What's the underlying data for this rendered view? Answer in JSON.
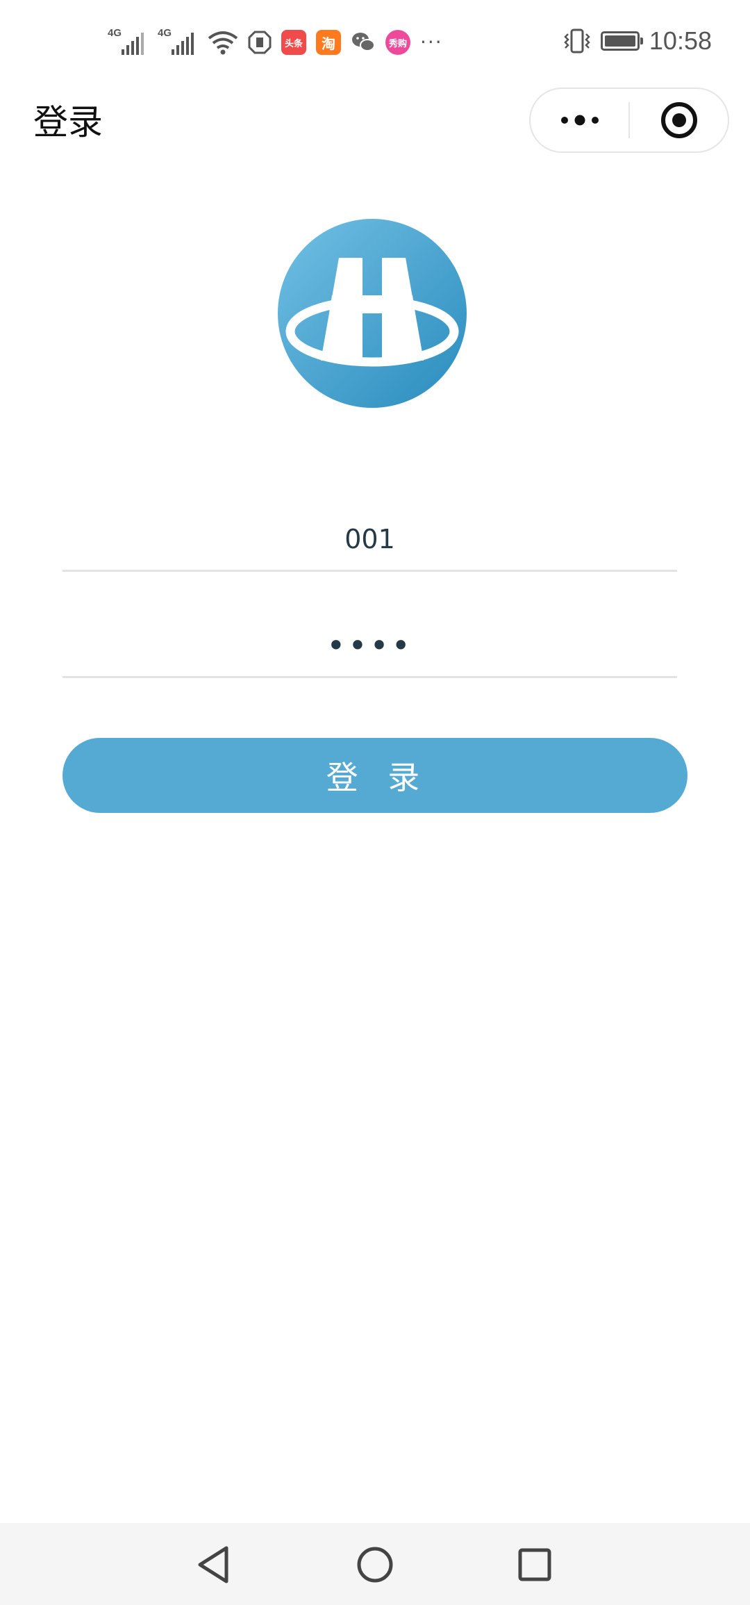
{
  "status_bar": {
    "network_1": "4G",
    "network_2": "4G",
    "app_icons": [
      {
        "name": "toutiao-icon",
        "label": "头条",
        "color": "#f04a4a"
      },
      {
        "name": "taobao-icon",
        "label": "淘",
        "color": "#ff7a1f"
      },
      {
        "name": "wechat-icon",
        "label": "",
        "color": "#666666"
      },
      {
        "name": "xiuchang-icon",
        "label": "秀购",
        "color": "#ee4a9b"
      }
    ],
    "more_indicator": "···",
    "battery_level": 0.95,
    "time": "10:58"
  },
  "nav": {
    "title": "登录",
    "more_icon": "more-dots-icon",
    "close_icon": "target-close-icon"
  },
  "logo": {
    "icon": "highway-logo-icon",
    "color_start": "#6dbde2",
    "color_end": "#2e8fbf"
  },
  "form": {
    "username_value": "001",
    "password_value": "1234",
    "submit_label": "登 录"
  },
  "colors": {
    "accent": "#55aad4",
    "input_text": "#253a47",
    "divider": "#e3e3e3"
  },
  "system_nav": {
    "back_icon": "back-triangle-icon",
    "home_icon": "home-circle-icon",
    "recents_icon": "recents-square-icon"
  }
}
